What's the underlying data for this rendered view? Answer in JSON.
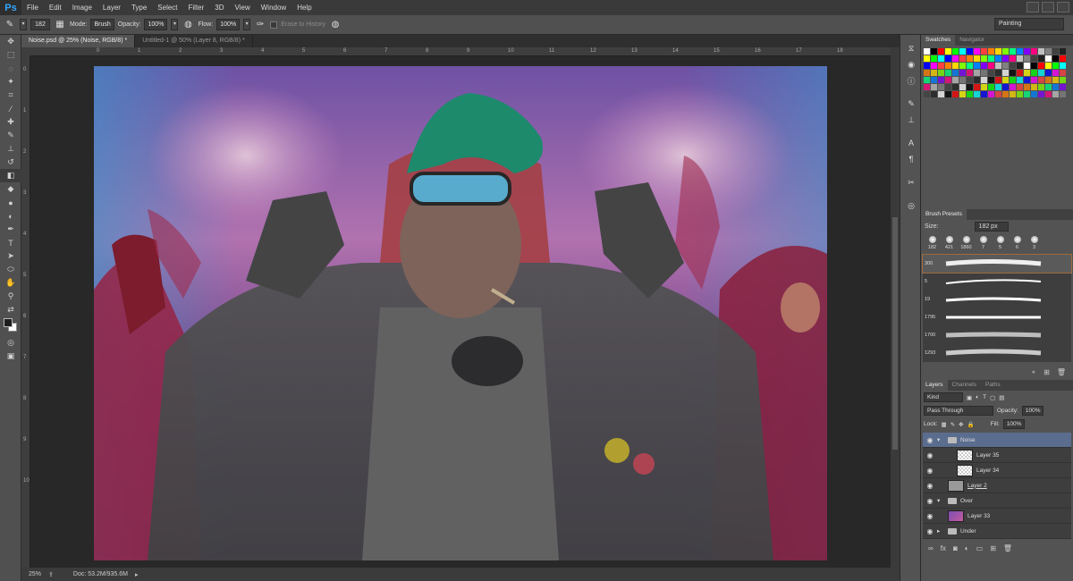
{
  "menu": {
    "logo": "Ps",
    "items": [
      "File",
      "Edit",
      "Image",
      "Layer",
      "Type",
      "Select",
      "Filter",
      "3D",
      "View",
      "Window",
      "Help"
    ]
  },
  "options": {
    "brush_size": "182",
    "mode_label": "Mode:",
    "mode_value": "Brush",
    "opacity_label": "Opacity:",
    "opacity_value": "100%",
    "flow_label": "Flow:",
    "flow_value": "100%",
    "erase_history": "Erase to History",
    "workspace": "Painting"
  },
  "tabs": [
    {
      "label": "Noise.psd @ 25% (Noise, RGB/8) *",
      "active": true
    },
    {
      "label": "Untitled-1 @ 50% (Layer 8, RGB/8) *",
      "active": false
    }
  ],
  "rulers": {
    "top": [
      "0",
      "1",
      "2",
      "3",
      "4",
      "5",
      "6",
      "7",
      "8",
      "9",
      "10",
      "11",
      "12",
      "13",
      "14",
      "15",
      "16",
      "17",
      "18"
    ],
    "left": [
      "0",
      "1",
      "2",
      "3",
      "4",
      "5",
      "6",
      "7",
      "8",
      "9",
      "10"
    ]
  },
  "status": {
    "zoom": "25%",
    "doc": "Doc: 53.2M/935.6M"
  },
  "panels": {
    "swatches_tab": "Swatches",
    "navigator_tab": "Navigator",
    "brush_presets_tab": "Brush Presets",
    "size_label": "Size:",
    "size_value": "182 px",
    "tips": [
      "182",
      "421",
      "1860",
      "7",
      "5",
      "6",
      "3"
    ],
    "strokes": [
      "300",
      "5",
      "19",
      "1795",
      "1700",
      "1293"
    ],
    "layers_tab": "Layers",
    "channels_tab": "Channels",
    "paths_tab": "Paths",
    "kind": "Kind",
    "blend": "Pass Through",
    "opacity_label": "Opacity:",
    "opacity_value": "100%",
    "lock_label": "Lock:",
    "fill_label": "Fill:",
    "fill_value": "100%",
    "layers": [
      "Noise",
      "Layer 35",
      "Layer 34",
      "Layer 2",
      "Over",
      "Layer 33",
      "Under"
    ]
  },
  "colors": {
    "swatches": [
      "#ffffff",
      "#000000",
      "#ff0000",
      "#ffff00",
      "#00ff00",
      "#00ffff",
      "#0000ff",
      "#ff00ff",
      "#ff4040",
      "#ff8000",
      "#ffd700",
      "#80ff00",
      "#00ff80",
      "#0080ff",
      "#8000ff",
      "#ff0080",
      "#c0c0c0",
      "#808080",
      "#404040",
      "#202020"
    ]
  }
}
